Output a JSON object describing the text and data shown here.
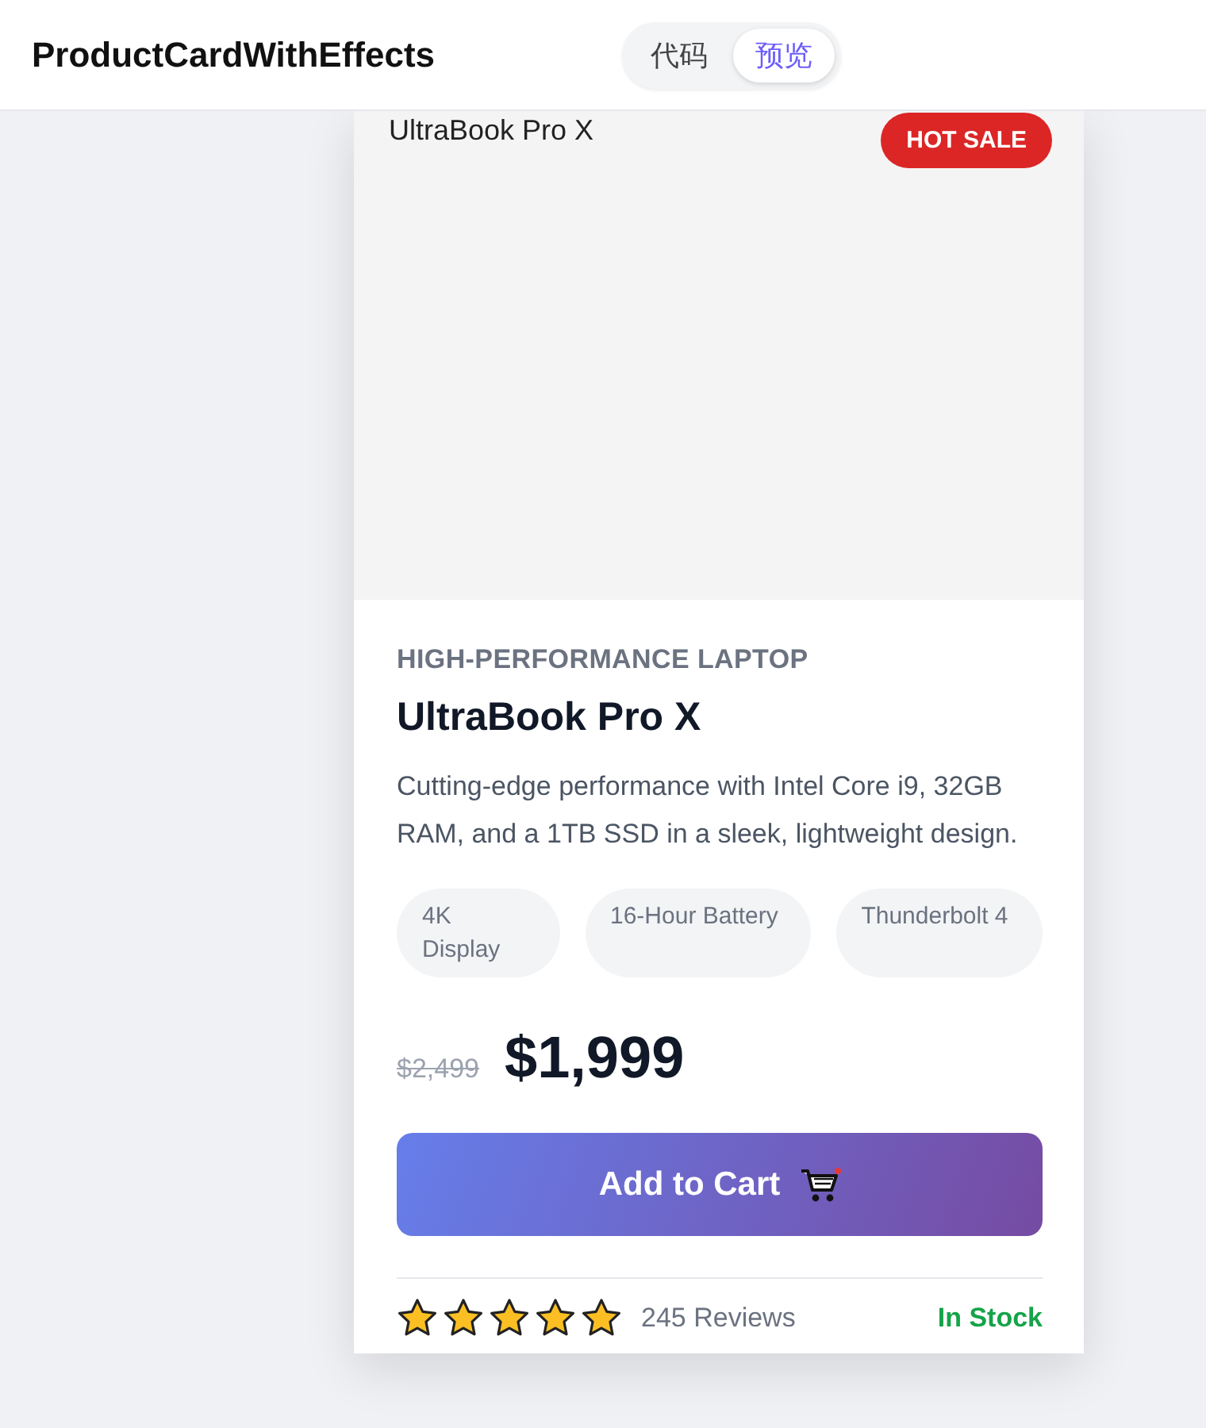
{
  "header": {
    "title": "ProductCardWithEffects",
    "tabs": [
      {
        "label": "代码",
        "selected": false
      },
      {
        "label": "预览",
        "selected": true
      }
    ]
  },
  "product": {
    "image_alt": "UltraBook Pro X",
    "badge": "HOT SALE",
    "category": "HIGH-PERFORMANCE LAPTOP",
    "name": "UltraBook Pro X",
    "description": "Cutting-edge performance with Intel Core i9, 32GB RAM, and a 1TB SSD in a sleek, lightweight design.",
    "features": [
      "4K Display",
      "16-Hour Battery",
      "Thunderbolt 4"
    ],
    "old_price": "$2,499",
    "price": "$1,999",
    "button": "Add to Cart",
    "stars": 5,
    "reviews": "245 Reviews",
    "stock": "In Stock"
  }
}
